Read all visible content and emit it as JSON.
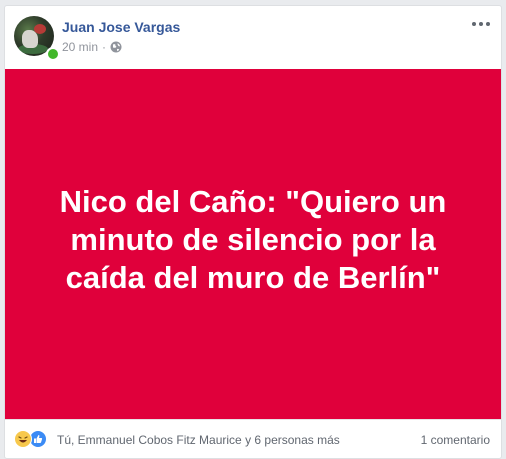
{
  "post": {
    "author": "Juan Jose Vargas",
    "time": "20 min",
    "separator": "·",
    "privacy_icon": "globe-icon",
    "more_icon": "more-options-icon",
    "online_color": "#42b72a",
    "background_color": "#e0003b",
    "headline": "Nico del Caño: \"Quiero un minuto de silencio por la caída del muro de Berlín\""
  },
  "footer": {
    "reaction_icons": [
      "haha-reaction-icon",
      "like-reaction-icon"
    ],
    "reactors": "Tú, Emmanuel Cobos Fitz Maurice y 6 personas más",
    "comments": "1 comentario"
  }
}
